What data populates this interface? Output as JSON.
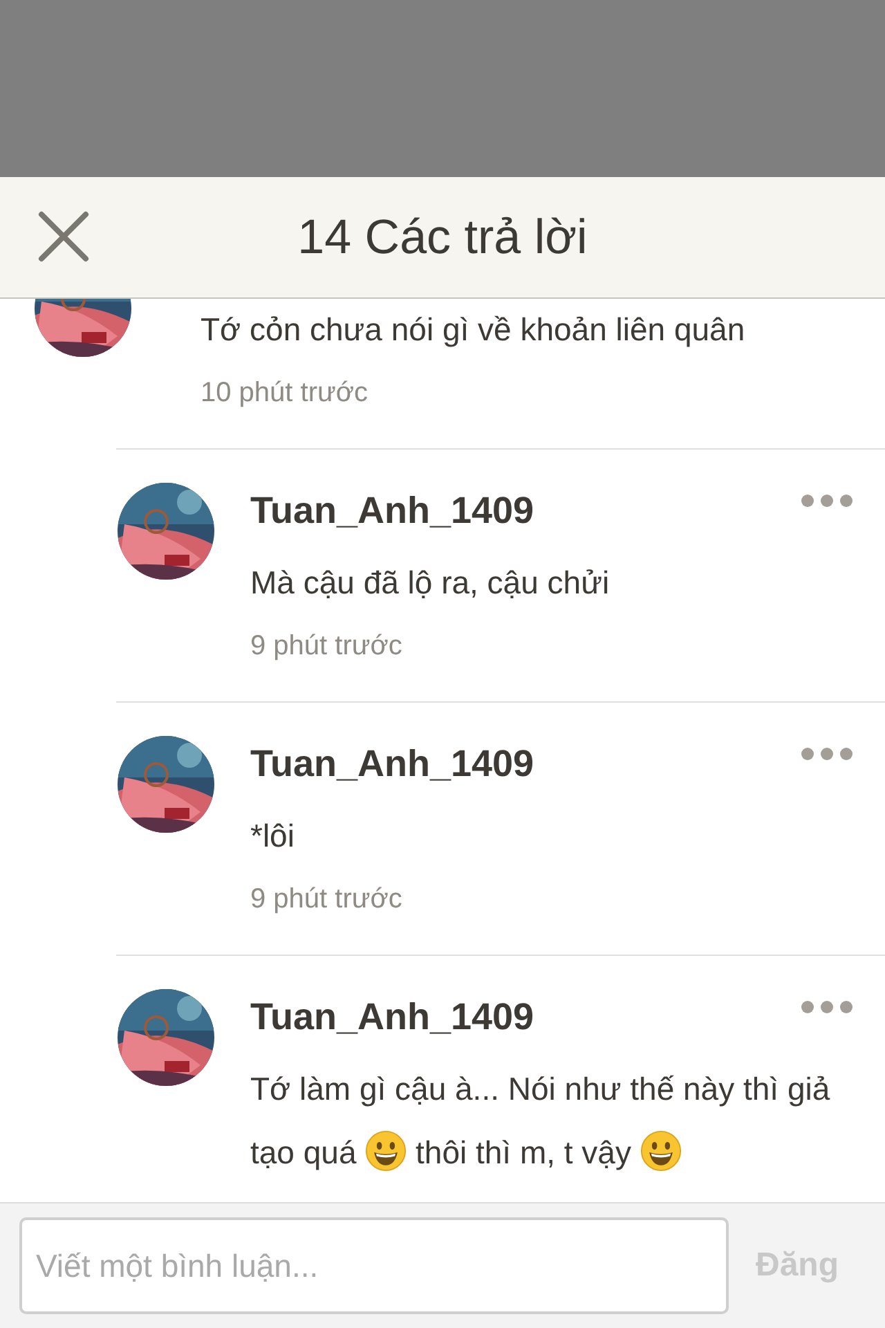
{
  "header": {
    "title": "14 Các trả lời"
  },
  "top_comment": {
    "body": [
      {
        "kind": "text",
        "text": "Tớ cỏn chưa nói gì về khoản liên quân"
      }
    ],
    "time": "10 phút trước"
  },
  "replies": [
    {
      "author": "Tuan_Anh_1409",
      "body": [
        {
          "kind": "text",
          "text": "Mà cậu đã lộ ra, cậu chửi"
        }
      ],
      "time": "9 phút trước"
    },
    {
      "author": "Tuan_Anh_1409",
      "body": [
        {
          "kind": "text",
          "text": "*lôi"
        }
      ],
      "time": "9 phút trước"
    },
    {
      "author": "Tuan_Anh_1409",
      "body": [
        {
          "kind": "text",
          "text": "Tớ làm gì cậu à... Nói như thế này thì giả tạo quá "
        },
        {
          "kind": "emoji"
        },
        {
          "kind": "text",
          "text": " thôi thì m, t vậy "
        },
        {
          "kind": "emoji"
        }
      ]
    }
  ],
  "composer": {
    "placeholder": "Viết một bình luận...",
    "submit": {
      "label": "Đăng",
      "disabled": true
    }
  }
}
